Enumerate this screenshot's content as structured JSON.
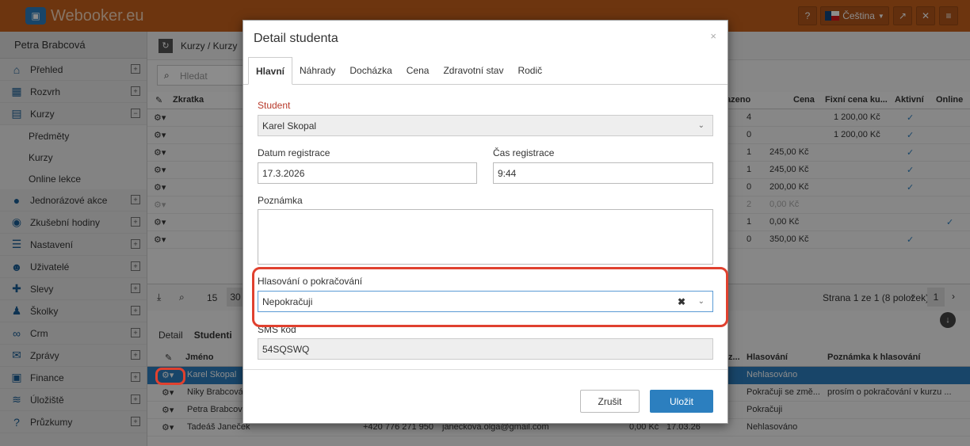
{
  "app": {
    "logo": "Webooker.eu",
    "language": "Čeština"
  },
  "sidebar": {
    "user": "Petra Brabcová",
    "items": [
      {
        "label": "Přehled",
        "icon": "home-icon"
      },
      {
        "label": "Rozvrh",
        "icon": "calendar-icon"
      },
      {
        "label": "Kurzy",
        "icon": "book-icon"
      },
      {
        "label": "Jednorázové akce",
        "icon": "ball-icon"
      },
      {
        "label": "Zkušební hodiny",
        "icon": "eye-icon"
      },
      {
        "label": "Nastavení",
        "icon": "settings-icon"
      },
      {
        "label": "Uživatelé",
        "icon": "users-icon"
      },
      {
        "label": "Slevy",
        "icon": "gift-icon"
      },
      {
        "label": "Školky",
        "icon": "child-icon"
      },
      {
        "label": "Crm",
        "icon": "handshake-icon"
      },
      {
        "label": "Zprávy",
        "icon": "mail-icon"
      },
      {
        "label": "Finance",
        "icon": "money-icon"
      },
      {
        "label": "Úložiště",
        "icon": "database-icon"
      },
      {
        "label": "Průzkumy",
        "icon": "question-icon"
      }
    ],
    "subitems": [
      "Předměty",
      "Kurzy",
      "Online lekce"
    ]
  },
  "main": {
    "breadcrumb": "Kurzy / Kurzy",
    "search_placeholder": "Hledat",
    "columns": {
      "abbr": "Zkratka",
      "assigned": "azeno",
      "price": "Cena",
      "fixed": "Fixní cena ku...",
      "active": "Aktivní",
      "online": "Online"
    },
    "rows": [
      {
        "n": "4",
        "price": "",
        "fixed": "1 200,00 Kč",
        "active": "✓",
        "online": ""
      },
      {
        "n": "0",
        "price": "",
        "fixed": "1 200,00 Kč",
        "active": "✓",
        "online": ""
      },
      {
        "n": "1",
        "price": "245,00 Kč",
        "fixed": "",
        "active": "✓",
        "online": ""
      },
      {
        "n": "1",
        "price": "245,00 Kč",
        "fixed": "",
        "active": "✓",
        "online": ""
      },
      {
        "n": "0",
        "price": "200,00 Kč",
        "fixed": "",
        "active": "✓",
        "online": ""
      },
      {
        "n": "2",
        "price": "0,00 Kč",
        "fixed": "",
        "active": "",
        "online": ""
      },
      {
        "n": "1",
        "price": "0,00 Kč",
        "fixed": "",
        "active": "",
        "online": "✓"
      },
      {
        "n": "0",
        "price": "350,00 Kč",
        "fixed": "",
        "active": "✓",
        "online": ""
      }
    ],
    "pager": {
      "size1": "15",
      "size2": "30",
      "info": "Strana 1 ze 1 (8 položek)",
      "page": "1"
    },
    "lower_tabs": [
      "Detail",
      "Studenti"
    ],
    "lower_columns": {
      "name": "Jméno",
      "z": "z...",
      "vote": "Hlasování",
      "note": "Poznámka k hlasování"
    },
    "students": [
      {
        "name": "Karel Skopal",
        "vote": "Nehlasováno",
        "note": ""
      },
      {
        "name": "Niky Brabcová",
        "vote": "Pokračuji se změ...",
        "note": "prosím o pokračování v kurzu ..."
      },
      {
        "name": "Petra Brabcová",
        "vote": "Pokračuji",
        "note": ""
      },
      {
        "name": "Tadeáš Janeček",
        "phone": "+420 776 271 950",
        "email": "janeckova.olga@gmail.com",
        "amount": "0,00 Kč",
        "date": "17.03.26",
        "vote": "Nehlasováno",
        "note": ""
      }
    ]
  },
  "modal": {
    "title": "Detail studenta",
    "tabs": [
      "Hlavní",
      "Náhrady",
      "Docházka",
      "Cena",
      "Zdravotní stav",
      "Rodič"
    ],
    "student_label": "Student",
    "student_value": "Karel Skopal",
    "reg_date_label": "Datum registrace",
    "reg_date": "17.3.2026",
    "reg_time_label": "Čas registrace",
    "reg_time": "9:44",
    "note_label": "Poznámka",
    "vote_label": "Hlasování o pokračování",
    "vote_value": "Nepokračuji",
    "sms_label": "SMS kód",
    "sms_value": "54SQSWQ",
    "cancel": "Zrušit",
    "save": "Uložit"
  },
  "colors": {
    "orange": "#c7621c",
    "blue": "#2c7fbf",
    "highlight": "#e0412f"
  }
}
